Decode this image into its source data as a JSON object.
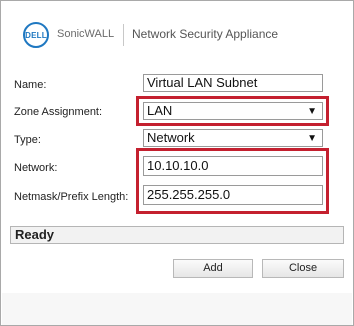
{
  "header": {
    "logo_text": "DELL",
    "brand": "SonicWALL",
    "product": "Network Security Appliance"
  },
  "form": {
    "name_label": "Name:",
    "name_value": "Virtual LAN Subnet",
    "zone_label": "Zone Assignment:",
    "zone_value": "LAN",
    "type_label": "Type:",
    "type_value": "Network",
    "network_label": "Network:",
    "network_value": "10.10.10.0",
    "netmask_label": "Netmask/Prefix Length:",
    "netmask_value": "255.255.255.0"
  },
  "status": {
    "text": "Ready"
  },
  "buttons": {
    "add_label": "Add",
    "close_label": "Close"
  },
  "icons": {
    "dropdown": "▼"
  },
  "colors": {
    "highlight": "#c4202f",
    "brand_blue": "#1f78c1"
  }
}
